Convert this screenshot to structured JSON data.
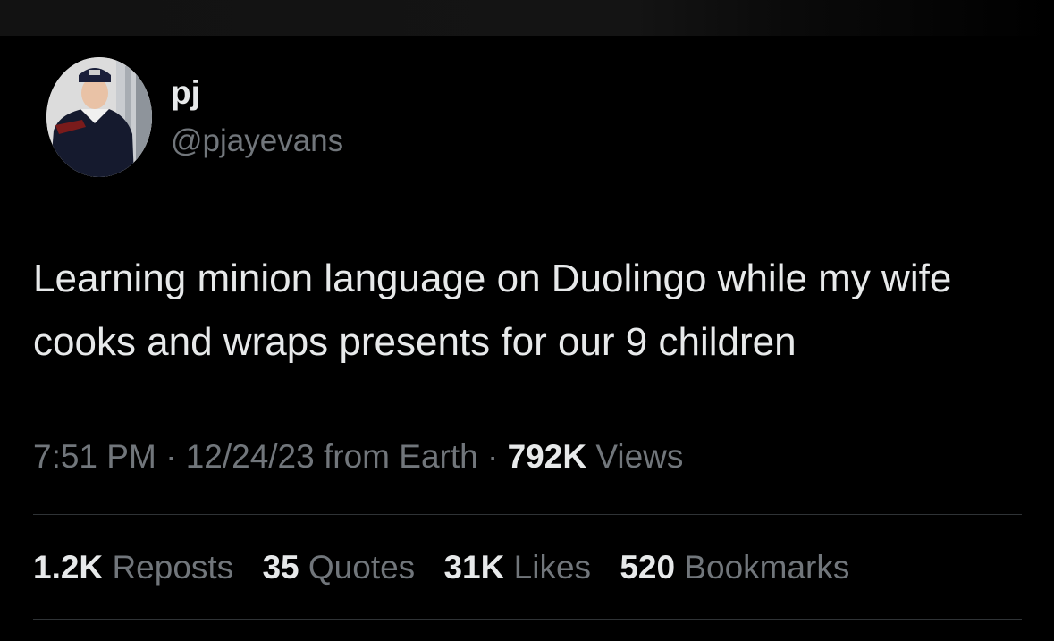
{
  "tweet": {
    "author": {
      "display_name": "pj",
      "handle": "@pjayevans",
      "avatar": "profile-photo"
    },
    "text": "Learning minion language on Duolingo while my wife cooks and wraps presents for our 9 children",
    "meta": {
      "time": "7:51 PM",
      "separator": "·",
      "date_source": "12/24/23 from Earth",
      "views_count": "792K",
      "views_label": "Views"
    },
    "stats": {
      "reposts": {
        "count": "1.2K",
        "label": "Reposts"
      },
      "quotes": {
        "count": "35",
        "label": "Quotes"
      },
      "likes": {
        "count": "31K",
        "label": "Likes"
      },
      "bookmarks": {
        "count": "520",
        "label": "Bookmarks"
      }
    }
  },
  "colors": {
    "background": "#000000",
    "primary_text": "#e7e9ea",
    "secondary_text": "#71767b",
    "divider": "#2f3336"
  }
}
